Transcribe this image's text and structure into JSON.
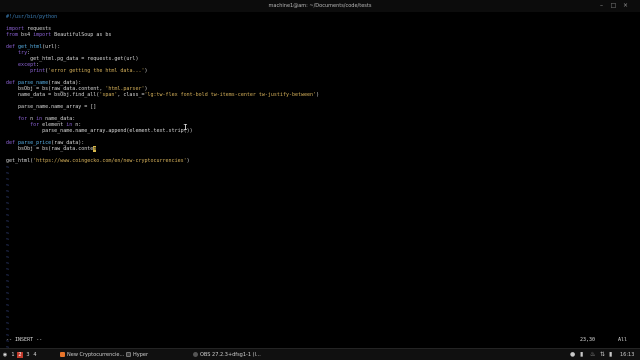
{
  "window": {
    "title": "machine1@am: ~/Documents/code/tests",
    "controls": [
      "minimize",
      "maximize",
      "close"
    ]
  },
  "editor": {
    "lines": [
      [
        {
          "t": "#!/usr/bin/python",
          "c": "cm"
        }
      ],
      [],
      [
        {
          "t": "import",
          "c": "kw"
        },
        {
          "t": " requests",
          "c": ""
        }
      ],
      [
        {
          "t": "from",
          "c": "kw"
        },
        {
          "t": " bs4 ",
          "c": ""
        },
        {
          "t": "import",
          "c": "kw"
        },
        {
          "t": " BeautifulSoup as bs",
          "c": ""
        }
      ],
      [],
      [
        {
          "t": "def",
          "c": "kw"
        },
        {
          "t": " ",
          "c": ""
        },
        {
          "t": "get_html",
          "c": "fn"
        },
        {
          "t": "(url):",
          "c": ""
        }
      ],
      [
        {
          "t": "    ",
          "c": ""
        },
        {
          "t": "try",
          "c": "kw"
        },
        {
          "t": ":",
          "c": ""
        }
      ],
      [
        {
          "t": "        get_html.pg_data = requests.get(url)",
          "c": ""
        }
      ],
      [
        {
          "t": "    ",
          "c": ""
        },
        {
          "t": "except",
          "c": "kw"
        },
        {
          "t": ":",
          "c": ""
        }
      ],
      [
        {
          "t": "        ",
          "c": ""
        },
        {
          "t": "print",
          "c": "kw"
        },
        {
          "t": "(",
          "c": ""
        },
        {
          "t": "'error getting the html data...'",
          "c": "str"
        },
        {
          "t": ")",
          "c": ""
        }
      ],
      [],
      [
        {
          "t": "def",
          "c": "kw"
        },
        {
          "t": " ",
          "c": ""
        },
        {
          "t": "parse_name",
          "c": "fn"
        },
        {
          "t": "(raw_data):",
          "c": ""
        }
      ],
      [
        {
          "t": "    bsObj = bs(raw_data.content, ",
          "c": ""
        },
        {
          "t": "'html.parser'",
          "c": "str"
        },
        {
          "t": ")",
          "c": ""
        }
      ],
      [
        {
          "t": "    name_data = bsObj.find_all(",
          "c": ""
        },
        {
          "t": "'span'",
          "c": "str"
        },
        {
          "t": ", class_=",
          "c": ""
        },
        {
          "t": "'lg:tw-flex font-bold tw-items-center tw-justify-between'",
          "c": "str"
        },
        {
          "t": ")",
          "c": ""
        }
      ],
      [],
      [
        {
          "t": "    parse_name.name_array = []",
          "c": ""
        }
      ],
      [],
      [
        {
          "t": "    ",
          "c": ""
        },
        {
          "t": "for",
          "c": "kw"
        },
        {
          "t": " n ",
          "c": ""
        },
        {
          "t": "in",
          "c": "kw"
        },
        {
          "t": " name_data:",
          "c": ""
        }
      ],
      [
        {
          "t": "        ",
          "c": ""
        },
        {
          "t": "for",
          "c": "kw"
        },
        {
          "t": " element ",
          "c": ""
        },
        {
          "t": "in",
          "c": "kw"
        },
        {
          "t": " n:",
          "c": ""
        }
      ],
      [
        {
          "t": "            parse_name.name_array.append(element.text.strip())",
          "c": ""
        }
      ],
      [],
      [
        {
          "t": "def",
          "c": "kw"
        },
        {
          "t": " ",
          "c": ""
        },
        {
          "t": "parse_price",
          "c": "fn"
        },
        {
          "t": "(raw_data):",
          "c": ""
        }
      ],
      [
        {
          "t": "    bsObj = bs(raw_data.conte",
          "c": ""
        },
        {
          "t": "n",
          "c": "cursor"
        }
      ],
      [],
      [
        {
          "t": "get_html(",
          "c": ""
        },
        {
          "t": "'https://www.coingecko.com/en/new-cryptocurrencies'",
          "c": "str"
        },
        {
          "t": ")",
          "c": ""
        }
      ]
    ],
    "tilde": "~",
    "tilde_count": 31
  },
  "status": {
    "mode": "-- INSERT --",
    "position": "23,30",
    "scroll": "All"
  },
  "taskbar": {
    "workspaces": [
      "1",
      "2",
      "3",
      "4"
    ],
    "active_workspace": "2",
    "tasks": [
      {
        "label": "New Cryptocurrencie...",
        "icon": "firefox-icon",
        "color": "#e8742a"
      },
      {
        "label": "Hyper",
        "icon": "terminal-icon",
        "color": "#3a3a3a"
      },
      {
        "label": "OBS 27.2.3+dfsg1-1 (I...",
        "icon": "obs-icon",
        "color": "#555555"
      }
    ],
    "tray_icons": [
      "color-picker-icon",
      "clipboard-icon",
      "volume-icon",
      "network-icon",
      "battery-icon"
    ],
    "clock": "16:13"
  }
}
